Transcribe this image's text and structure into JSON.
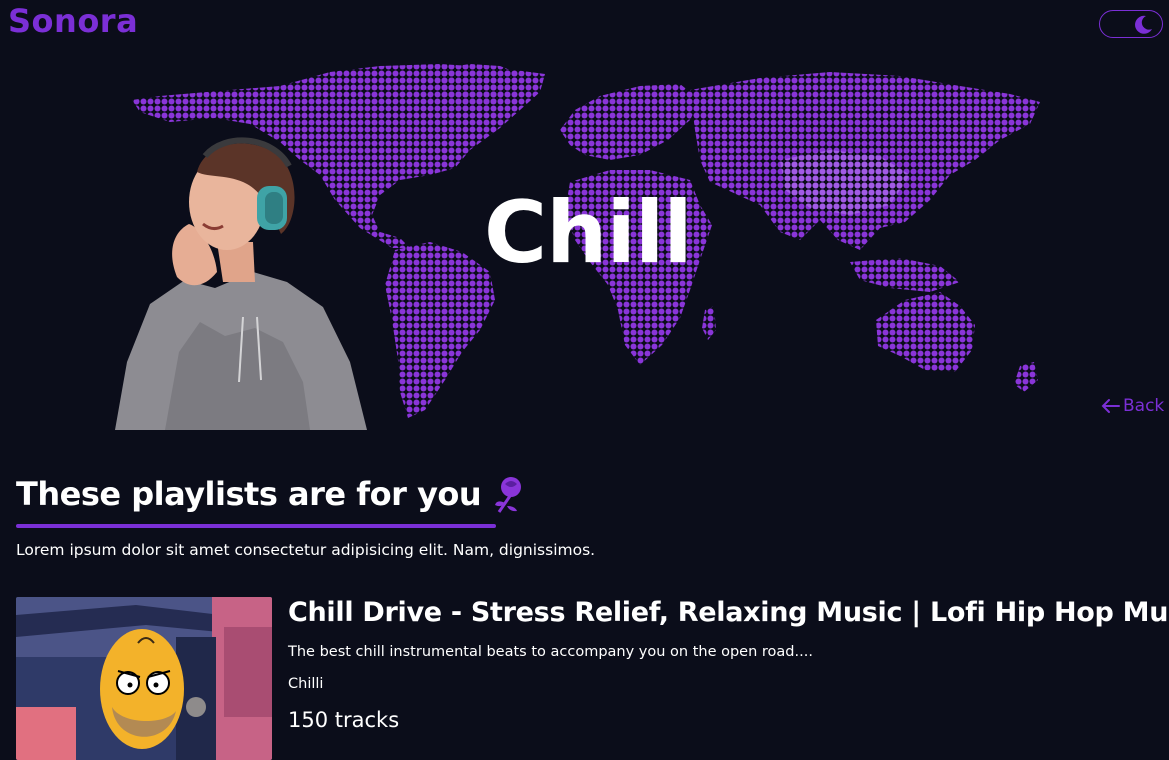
{
  "app": {
    "logo": "Sonora"
  },
  "hero": {
    "title": "Chill",
    "back_label": "Back"
  },
  "section": {
    "title": "These playlists are for you",
    "description": "Lorem ipsum dolor sit amet consectetur adipisicing elit. Nam, dignissimos."
  },
  "playlists": [
    {
      "title": "Chill Drive - Stress Relief, Relaxing Music | Lofi Hip Hop Music",
      "description": "The best chill instrumental beats to accompany you on the open road....",
      "owner": "Chilli",
      "tracks": "150 tracks"
    }
  ],
  "colors": {
    "accent": "#7b2fd6",
    "background": "#0b0d1a",
    "map_dots": "#8a35d9"
  },
  "icons": {
    "theme": "moon-icon",
    "back": "arrow-left-icon",
    "section": "rose-icon"
  }
}
